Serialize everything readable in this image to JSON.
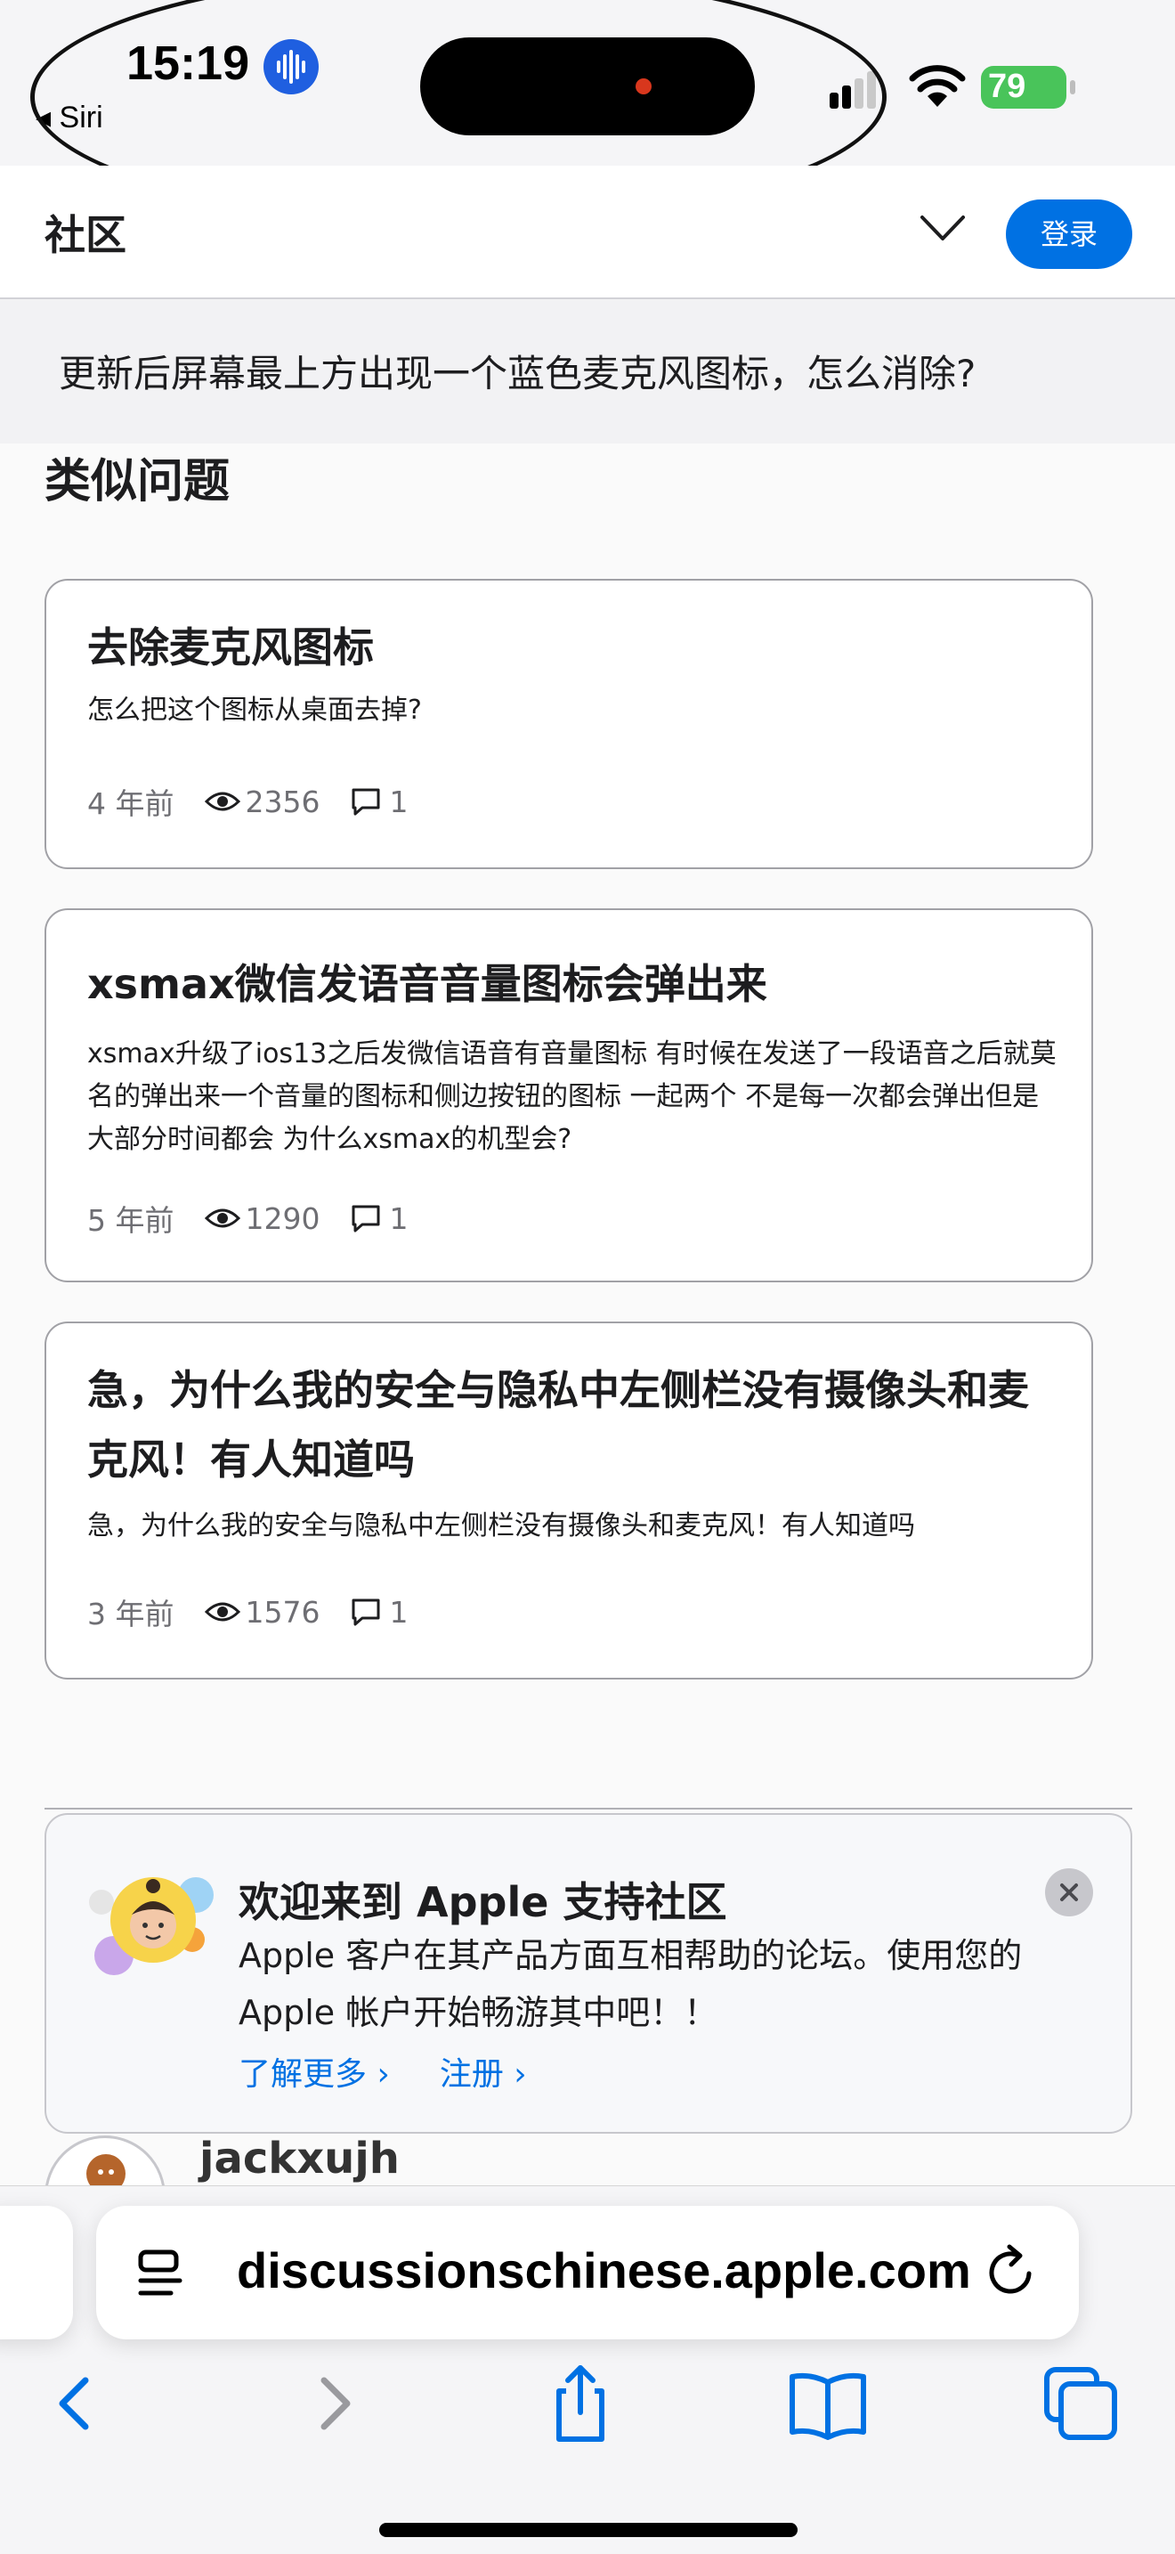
{
  "status": {
    "time": "15:19",
    "back_app": "Siri",
    "battery": "79"
  },
  "header": {
    "title": "社区",
    "login_label": "登录"
  },
  "question": "更新后屏幕最上方出现一个蓝色麦克风图标，怎么消除?",
  "similar": {
    "title": "类似问题",
    "items": [
      {
        "title": "去除麦克风图标",
        "desc": "怎么把这个图标从桌面去掉?",
        "age": "4 年前",
        "views": "2356",
        "replies": "1"
      },
      {
        "title": "xsmax微信发语音音量图标会弹出来",
        "desc": "xsmax升级了ios13之后发微信语音有音量图标 有时候在发送了一段语音之后就莫名的弹出来一个音量的图标和侧边按钮的图标 一起两个 不是每一次都会弹出但是大部分时间都会 为什么xsmax的机型会?",
        "age": "5 年前",
        "views": "1290",
        "replies": "1"
      },
      {
        "title": "急，为什么我的安全与隐私中左侧栏没有摄像头和麦克风！有人知道吗",
        "desc": "急，为什么我的安全与隐私中左侧栏没有摄像头和麦克风！有人知道吗",
        "age": "3 年前",
        "views": "1576",
        "replies": "1"
      }
    ]
  },
  "welcome": {
    "title": "欢迎来到 Apple 支持社区",
    "body": "Apple 客户在其产品方面互相帮助的论坛。使用您的 Apple 帐户开始畅游其中吧！！",
    "learn_more": "了解更多 ›",
    "register": "注册 ›"
  },
  "next_post": {
    "username": "jackxujh"
  },
  "browser": {
    "url": "discussionschinese.apple.com"
  },
  "colors": {
    "accent": "#0071e3",
    "battery": "#49c45a",
    "voice_indicator": "#1f5fe0"
  }
}
